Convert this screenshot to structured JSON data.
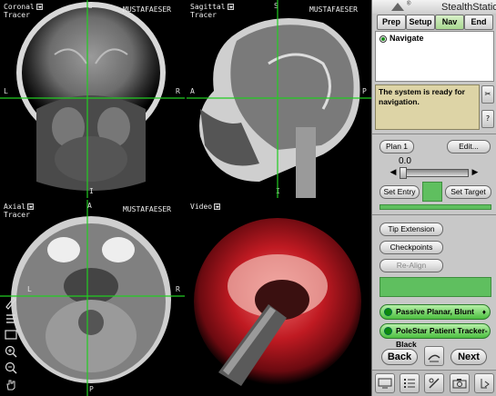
{
  "app": {
    "brand": "StealthStation",
    "brand_mark": "®"
  },
  "views": {
    "coronal": {
      "label": "Coronal",
      "sub": "Tracer",
      "patient": "MUSTAFAESER",
      "top": "S",
      "left": "L",
      "right": "R",
      "bottom": "I"
    },
    "sagittal": {
      "label": "Sagittal",
      "sub": "Tracer",
      "patient": "MUSTAFAESER",
      "top": "S",
      "left": "A",
      "right": "P",
      "bottom": "I"
    },
    "axial": {
      "label": "Axial",
      "sub": "Tracer",
      "patient": "MUSTAFAESER",
      "top": "A",
      "left": "L",
      "right": "R",
      "bottom": "P"
    },
    "video": {
      "label": "Video"
    }
  },
  "tabs": [
    {
      "label": "Prep"
    },
    {
      "label": "Setup"
    },
    {
      "label": "Nav"
    },
    {
      "label": "End"
    }
  ],
  "navigate": {
    "label": "Navigate"
  },
  "message": {
    "text": "The system is ready for navigation."
  },
  "plan": {
    "plan_label": "Plan 1",
    "edit_label": "Edit..."
  },
  "slider": {
    "value": "0.0"
  },
  "entry": {
    "set_entry": "Set Entry",
    "set_target": "Set Target"
  },
  "buttons": {
    "tip_extension": "Tip Extension",
    "checkpoints": "Checkpoints",
    "realign": "Re-Align"
  },
  "tools": [
    {
      "label": "Passive Planar, Blunt"
    },
    {
      "label": "PoleStar Patient Tracker-Black"
    }
  ],
  "nav_buttons": {
    "back": "Back",
    "next": "Next"
  },
  "colors": {
    "crosshair": "#22cc22",
    "status_green": "#5fbf5f",
    "active_tab": "#a8d890",
    "message_bg": "#ddd4a6"
  }
}
